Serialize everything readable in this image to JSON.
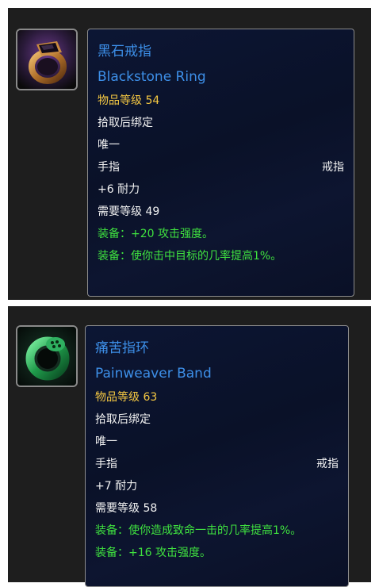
{
  "items": [
    {
      "icon": "black-stone-ring-icon",
      "name_cn": "黑石戒指",
      "name_en": "Blackstone Ring",
      "item_level": "物品等级 54",
      "binding": "拾取后绑定",
      "unique": "唯一",
      "slot": "手指",
      "type": "戒指",
      "stat": "+6 耐力",
      "required_level": "需要等级 49",
      "equip_1": "装备：+20 攻击强度。",
      "equip_2": "装备：使你击中目标的几率提高1%。"
    },
    {
      "icon": "green-serpent-ring-icon",
      "name_cn": "痛苦指环",
      "name_en": "Painweaver Band",
      "item_level": "物品等级 63",
      "binding": "拾取后绑定",
      "unique": "唯一",
      "slot": "手指",
      "type": "戒指",
      "stat": "+7 耐力",
      "required_level": "需要等级 58",
      "equip_1": "装备：使你造成致命一击的几率提高1%。",
      "equip_2": "装备：+16 攻击强度。"
    }
  ],
  "colors": {
    "name": "#3d8fe8",
    "item_level": "#f5c842",
    "equip": "#3fe23f",
    "text": "#f2f2f2",
    "tooltip_bg": "#0a1128",
    "panel_bg": "#1e1e1e"
  }
}
